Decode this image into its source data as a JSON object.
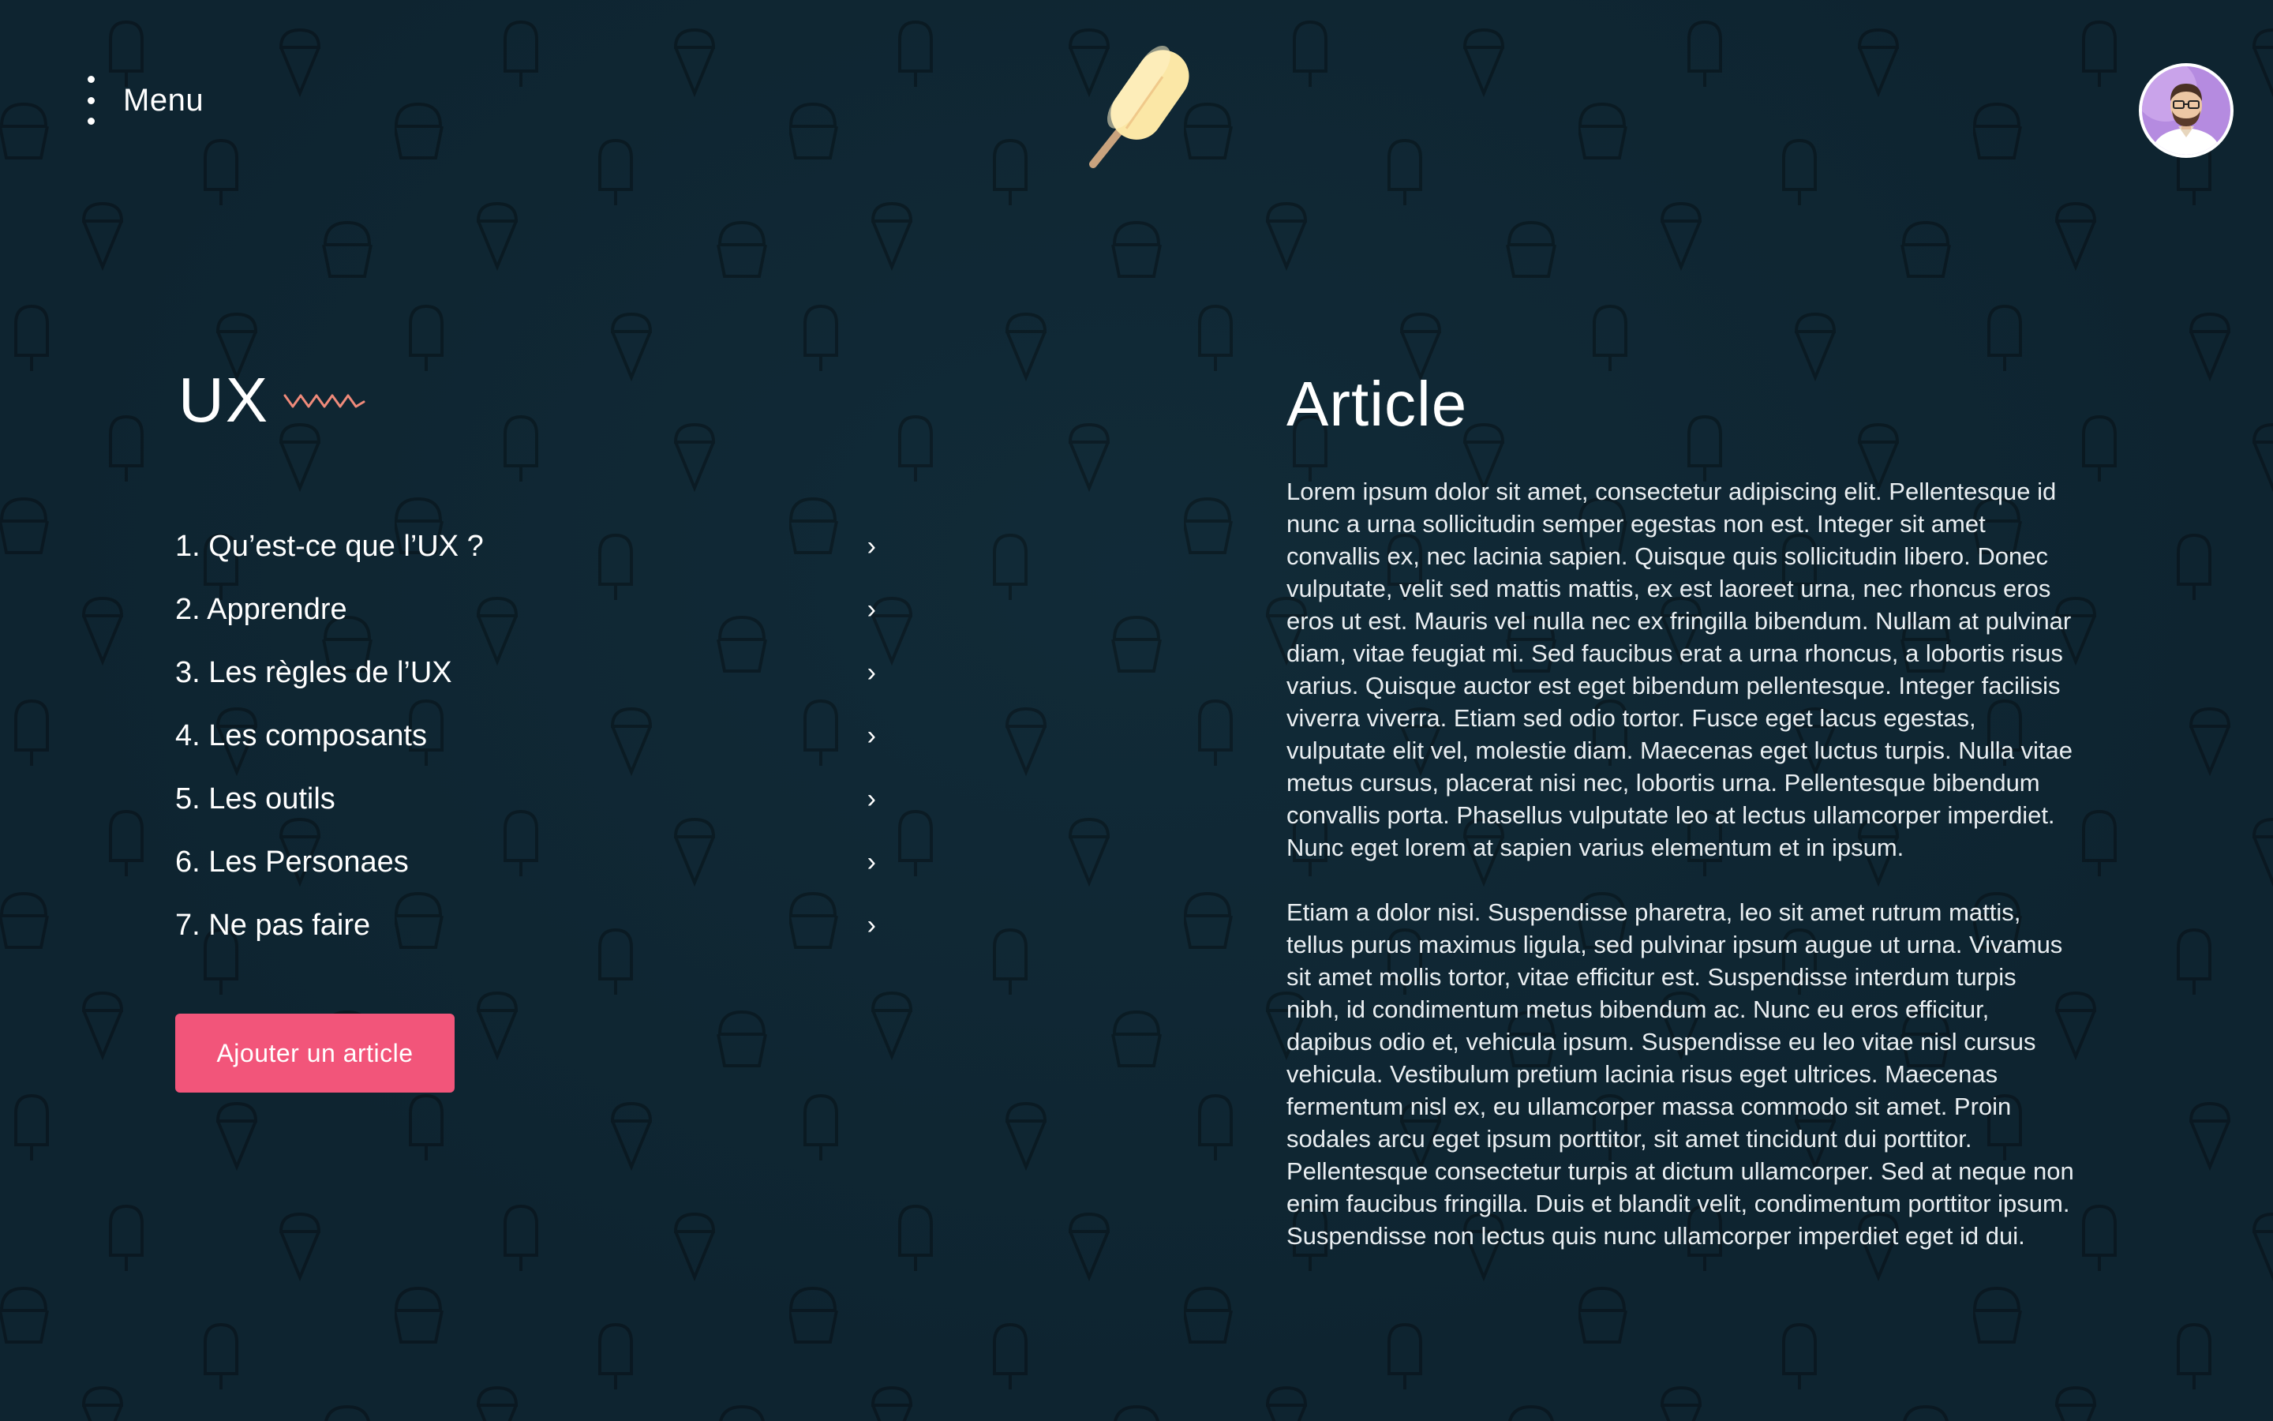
{
  "header": {
    "menu_label": "Menu"
  },
  "icons": {
    "menu": "kebab-menu-icon",
    "logo": "popsicle-logo",
    "avatar": "user-avatar",
    "title_decoration": "zigzag-icon",
    "chevron": "chevron-right-icon"
  },
  "colors": {
    "background": "#0e2430",
    "accent": "#f2557a",
    "zigzag": "#ef8a7a",
    "text": "#ffffff"
  },
  "sidebar": {
    "title": "UX",
    "items": [
      {
        "label": "1. Qu’est-ce que l’UX ?",
        "chevron": "›"
      },
      {
        "label": "2. Apprendre",
        "chevron": "›"
      },
      {
        "label": "3. Les règles de l’UX",
        "chevron": "›"
      },
      {
        "label": "4. Les composants",
        "chevron": "›"
      },
      {
        "label": "5. Les outils",
        "chevron": "›"
      },
      {
        "label": "6. Les Personaes",
        "chevron": "›"
      },
      {
        "label": "7. Ne pas faire",
        "chevron": "›"
      }
    ],
    "add_button_label": "Ajouter un article"
  },
  "article": {
    "title": "Article",
    "paragraphs": [
      "Lorem ipsum dolor sit amet, consectetur adipiscing elit. Pellentesque id nunc a urna sollicitudin semper egestas non est. Integer sit amet convallis ex, nec lacinia sapien. Quisque quis sollicitudin libero. Donec vulputate, velit sed mattis mattis, ex est laoreet urna, nec rhoncus eros eros ut est. Mauris vel nulla nec ex fringilla bibendum. Nullam at pulvinar diam, vitae feugiat mi. Sed faucibus erat a urna rhoncus, a lobortis risus varius. Quisque auctor est eget bibendum pellentesque. Integer facilisis viverra viverra. Etiam sed odio tortor. Fusce eget lacus egestas, vulputate elit vel, molestie diam. Maecenas eget luctus turpis. Nulla vitae metus cursus, placerat nisi nec, lobortis urna. Pellentesque bibendum convallis porta. Phasellus vulputate leo at lectus ullamcorper imperdiet. Nunc eget lorem at sapien varius elementum et in ipsum.",
      "Etiam a dolor nisi. Suspendisse pharetra, leo sit amet rutrum mattis, tellus purus maximus ligula, sed pulvinar ipsum augue ut urna. Vivamus sit amet mollis tortor, vitae efficitur est. Suspendisse interdum turpis nibh, id condimentum metus bibendum ac. Nunc eu eros efficitur, dapibus odio et, vehicula ipsum. Suspendisse eu leo vitae nisl cursus vehicula. Vestibulum pretium lacinia risus eget ultrices. Maecenas fermentum nisl ex, eu ullamcorper massa commodo sit amet. Proin sodales arcu eget ipsum porttitor, sit amet tincidunt dui porttitor. Pellentesque consectetur turpis at dictum ullamcorper. Sed at neque non enim faucibus fringilla. Duis et blandit velit, condimentum porttitor ipsum. Suspendisse non lectus quis nunc ullamcorper imperdiet eget id dui."
    ]
  }
}
